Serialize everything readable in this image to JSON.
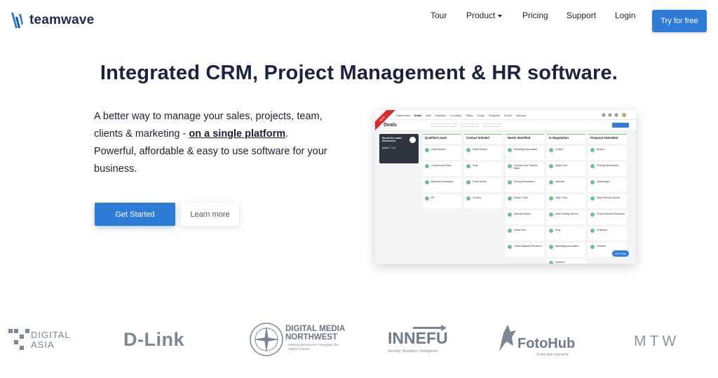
{
  "brand": {
    "name": "teamwave",
    "accent": "#2f7bd8"
  },
  "nav": {
    "tour": "Tour",
    "product": "Product",
    "pricing": "Pricing",
    "support": "Support",
    "login": "Login",
    "try_free": "Try for free"
  },
  "hero": {
    "headline": "Integrated CRM, Project Management & HR software.",
    "desc_part1": "A better way to manage your sales, projects, team, clients & marketing - ",
    "desc_link": "on a single platform",
    "desc_part2": ". Powerful, affordable & easy to use software for your business.",
    "get_started": "Get Started",
    "learn_more": "Learn more"
  },
  "app_preview": {
    "nav_items": [
      "Dashboard",
      "Deals",
      "Mail",
      "Activities",
      "Contacts",
      "Tasks",
      "Goals",
      "Progress",
      "Forms",
      "Reports"
    ],
    "active_nav": "Deals",
    "title": "Deals",
    "ribbon": "NEW",
    "tooltip_title": "Result for Leads Discovered",
    "tooltip_line": "Deals 7 / 10",
    "help": "Get Help",
    "columns": [
      {
        "name": "Qualified Leads",
        "cards": [
          "David Motors",
          "Commercial Press",
          "Berkshire Holdaway",
          "BP"
        ]
      },
      {
        "name": "Contact Initiated",
        "cards": [
          "David Motors",
          "King",
          "Power Mobil",
          "Chonny"
        ]
      },
      {
        "name": "Needs Identified",
        "cards": [
          "Marketing Associates",
          "Thunder And Trueline Miller",
          "Pricing Dimensions",
          "Rusty F shef",
          "Marcelli Motors",
          "Skate Grid",
          "China National Petroleum"
        ]
      },
      {
        "name": "In Negotiation",
        "cards": [
          "Champ",
          "Skate Grid",
          "Walmart",
          "Tiger Trust",
          "Data Printing Service",
          "King",
          "Marketing Associates",
          "Chennel"
        ]
      },
      {
        "name": "Proposal Submitted",
        "cards": [
          "Bostrot",
          "Printing Dimensions",
          "Volkswagen",
          "Daily Printing Service",
          "China National Petroleum",
          "Chapman",
          "Chinese"
        ]
      }
    ],
    "tooltip_dark": "#2f3640"
  },
  "clients": {
    "digital_asia": "DIGITAL ASIA",
    "dlink": "D-Link",
    "dm_line1": "DIGITAL MEDIA",
    "dm_line2": "NORTHWEST",
    "dm_tag": "Helping Businesses Navigate The Digital Frontier",
    "innefu": "INNEFU",
    "innefu_tag": "Security | Analytics | Intelligence",
    "fotohub": "FotoHub",
    "fotohub_tag": "From this moment",
    "mtw": "MTW"
  }
}
